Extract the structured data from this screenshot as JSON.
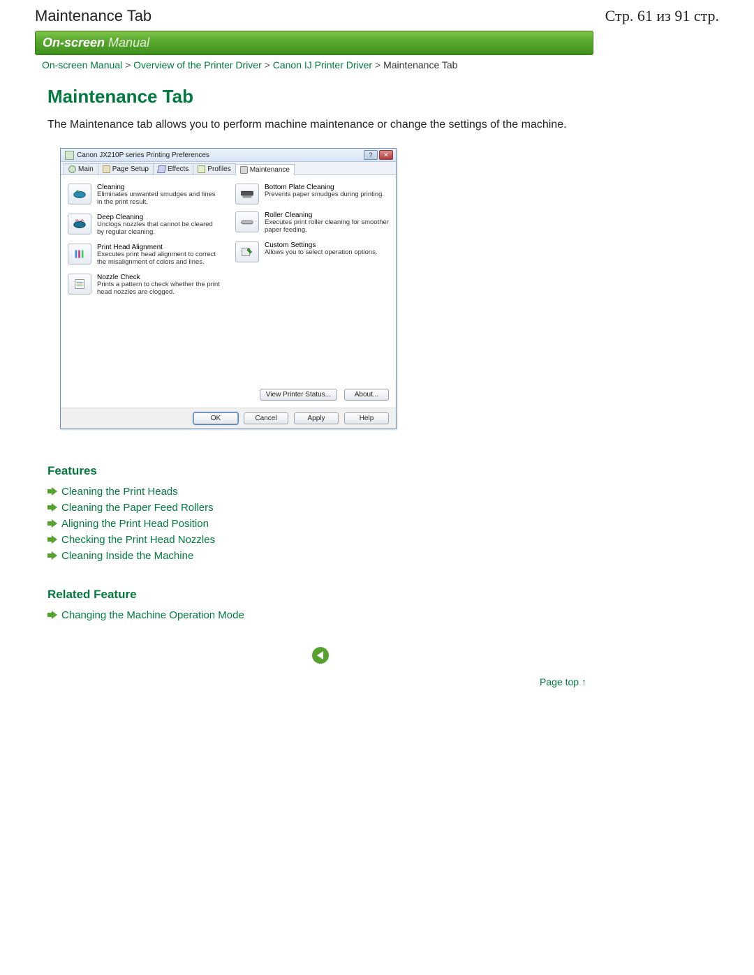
{
  "header": {
    "left": "Maintenance Tab",
    "right": "Стр. 61 из 91 стр."
  },
  "banner": {
    "bold": "On-screen",
    "light": " Manual"
  },
  "breadcrumbs": {
    "items": [
      {
        "label": "On-screen Manual",
        "link": true
      },
      {
        "label": "Overview of the Printer Driver",
        "link": true
      },
      {
        "label": "Canon IJ Printer Driver",
        "link": true
      },
      {
        "label": "Maintenance Tab",
        "link": false
      }
    ],
    "sep": ">"
  },
  "page": {
    "title": "Maintenance Tab",
    "intro": "The Maintenance tab allows you to perform machine maintenance or change the settings of the machine."
  },
  "dialog": {
    "title": "Canon JX210P series Printing Preferences",
    "tabs": [
      "Main",
      "Page Setup",
      "Effects",
      "Profiles",
      "Maintenance"
    ],
    "active_tab": "Maintenance",
    "left_items": [
      {
        "title": "Cleaning",
        "desc": "Eliminates unwanted smudges and lines in the print result."
      },
      {
        "title": "Deep Cleaning",
        "desc": "Unclogs nozzles that cannot be cleared by regular cleaning."
      },
      {
        "title": "Print Head Alignment",
        "desc": "Executes print head alignment to correct the misalignment of colors and lines."
      },
      {
        "title": "Nozzle Check",
        "desc": "Prints a pattern to check whether the print head nozzles are clogged."
      }
    ],
    "right_items": [
      {
        "title": "Bottom Plate Cleaning",
        "desc": "Prevents paper smudges during printing."
      },
      {
        "title": "Roller Cleaning",
        "desc": "Executes print roller cleaning for smoother paper feeding."
      },
      {
        "title": "Custom Settings",
        "desc": "Allows you to select operation options."
      }
    ],
    "mid_buttons": {
      "status": "View Printer Status...",
      "about": "About..."
    },
    "footer_buttons": {
      "ok": "OK",
      "cancel": "Cancel",
      "apply": "Apply",
      "help": "Help"
    }
  },
  "features": {
    "heading": "Features",
    "items": [
      "Cleaning the Print Heads",
      "Cleaning the Paper Feed Rollers",
      "Aligning the Print Head Position",
      "Checking the Print Head Nozzles",
      "Cleaning Inside the Machine"
    ]
  },
  "related": {
    "heading": "Related Feature",
    "items": [
      "Changing the Machine Operation Mode"
    ]
  },
  "page_top": "Page top"
}
